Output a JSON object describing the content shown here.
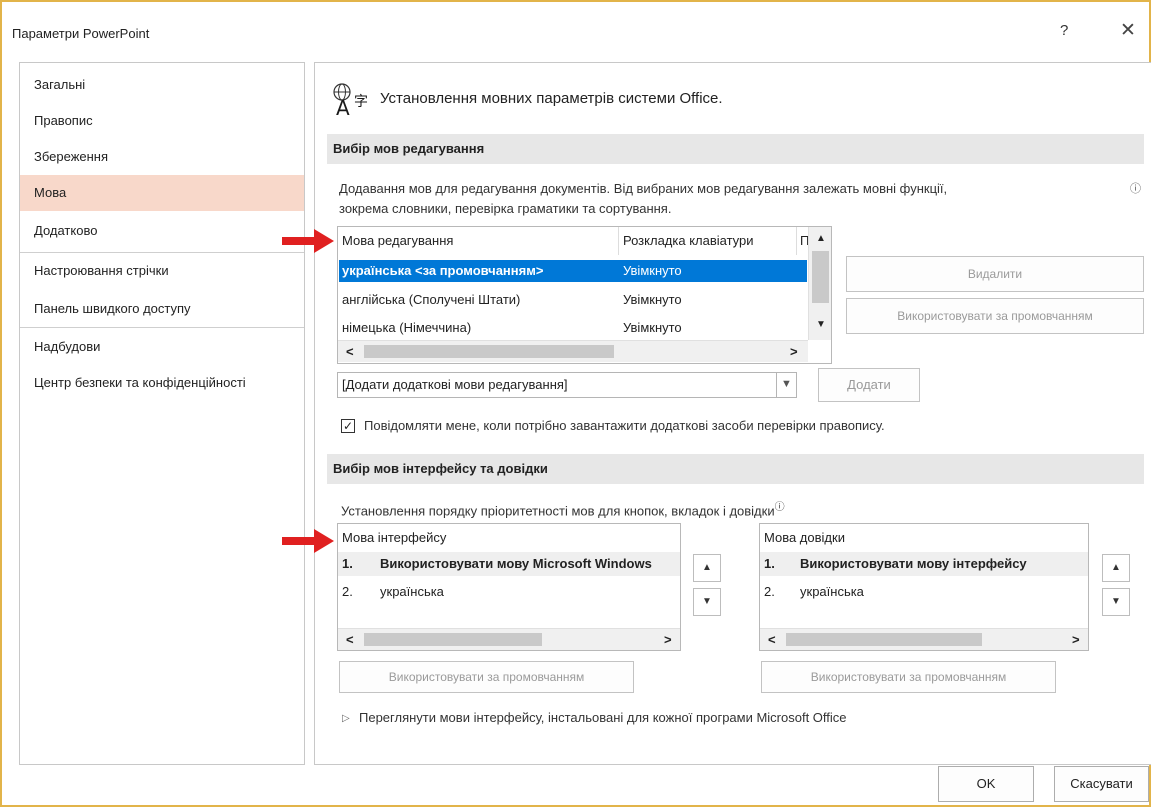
{
  "window": {
    "title": "Параметри PowerPoint",
    "help_label": "?",
    "close_label": "✕"
  },
  "sidebar": {
    "items": [
      {
        "label": "Загальні"
      },
      {
        "label": "Правопис"
      },
      {
        "label": "Збереження"
      },
      {
        "label": "Мова"
      },
      {
        "label": "Додатково"
      },
      {
        "label": "Настроювання стрічки"
      },
      {
        "label": "Панель швидкого доступу"
      },
      {
        "label": "Надбудови"
      },
      {
        "label": "Центр безпеки та конфіденційності"
      }
    ],
    "active_index": 3
  },
  "main": {
    "title": "Установлення мовних параметрів системи Office.",
    "editing": {
      "header": "Вибір мов редагування",
      "description_line1": "Додавання мов для редагування документів. Від вибраних мов редагування залежать мовні функції,",
      "description_line2": "зокрема словники, перевірка граматики та сортування.",
      "info_icon": "ⓘ",
      "columns": [
        "Мова редагування",
        "Розкладка клавіатури",
        "П"
      ],
      "rows": [
        {
          "language": "українська <за промовчанням>",
          "layout": "Увімкнуто",
          "selected": true
        },
        {
          "language": "англійська (Сполучені Штати)",
          "layout": "Увімкнуто",
          "selected": false
        },
        {
          "language": "німецька (Німеччина)",
          "layout": "Увімкнуто",
          "selected": false
        }
      ],
      "remove_button": "Видалити",
      "set_default_button": "Використовувати за промовчанням",
      "add_dropdown_value": "[Додати додаткові мови редагування]",
      "add_button": "Додати",
      "notify_checkbox_label": "Повідомляти мене, коли потрібно завантажити додаткові засоби перевірки правопису.",
      "notify_checked": true,
      "check_mark": "✓"
    },
    "interface": {
      "header": "Вибір мов інтерфейсу та довідки",
      "description": "Установлення порядку пріоритетності мов для кнопок, вкладок і довідки",
      "info_icon": "ⓘ",
      "ui_list": {
        "header": "Мова інтерфейсу",
        "items": [
          {
            "num": "1.",
            "label": "Використовувати мову Microsoft Windows",
            "bold": true
          },
          {
            "num": "2.",
            "label": "українська",
            "bold": false
          }
        ],
        "default_button": "Використовувати за промовчанням"
      },
      "help_list": {
        "header": "Мова довідки",
        "items": [
          {
            "num": "1.",
            "label": "Використовувати мову інтерфейсу",
            "bold": true
          },
          {
            "num": "2.",
            "label": "українська",
            "bold": false
          }
        ],
        "default_button": "Використовувати за промовчанням"
      },
      "view_link": "Переглянути мови інтерфейсу, інстальовані для кожної програми Microsoft Office",
      "expand_icon": "▷"
    },
    "arrows": {
      "up": "▲",
      "down": "▼",
      "left": "<",
      "right": ">"
    }
  },
  "footer": {
    "ok_button": "OK",
    "cancel_button": "Скасувати"
  },
  "colors": {
    "accent": "#0078d7",
    "active_nav": "#f8d8ca",
    "frame_border": "#e2b44a",
    "annotation_arrow": "#e02020"
  }
}
